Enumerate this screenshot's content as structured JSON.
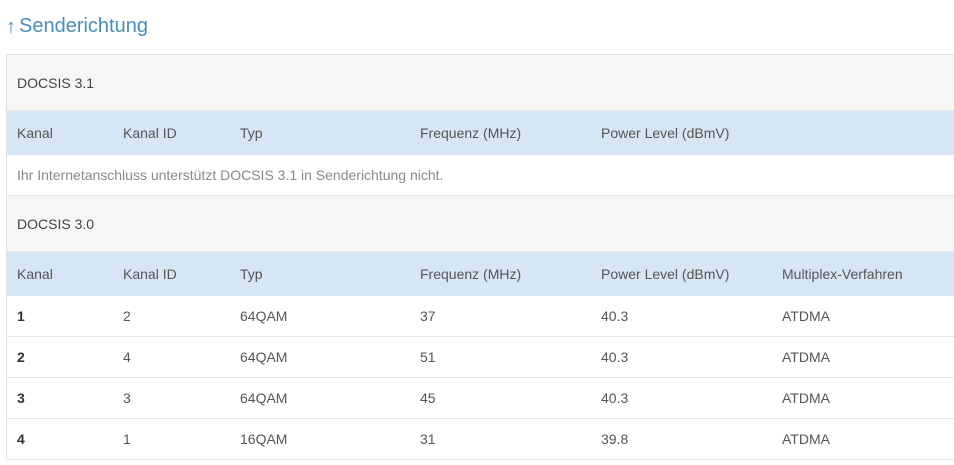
{
  "heading": {
    "arrow": "↑",
    "label": "Senderichtung"
  },
  "docsis31": {
    "title": "DOCSIS 3.1",
    "columns": [
      "Kanal",
      "Kanal ID",
      "Typ",
      "Frequenz (MHz)",
      "Power Level (dBmV)"
    ],
    "note": "Ihr Internetanschluss unterstützt DOCSIS 3.1 in Senderichtung nicht."
  },
  "docsis30": {
    "title": "DOCSIS 3.0",
    "columns": [
      "Kanal",
      "Kanal ID",
      "Typ",
      "Frequenz (MHz)",
      "Power Level (dBmV)",
      "Multiplex-Verfahren"
    ],
    "rows": [
      [
        "1",
        "2",
        "64QAM",
        "37",
        "40.3",
        "ATDMA"
      ],
      [
        "2",
        "4",
        "64QAM",
        "51",
        "40.3",
        "ATDMA"
      ],
      [
        "3",
        "3",
        "64QAM",
        "45",
        "40.3",
        "ATDMA"
      ],
      [
        "4",
        "1",
        "16QAM",
        "31",
        "39.8",
        "ATDMA"
      ]
    ]
  }
}
